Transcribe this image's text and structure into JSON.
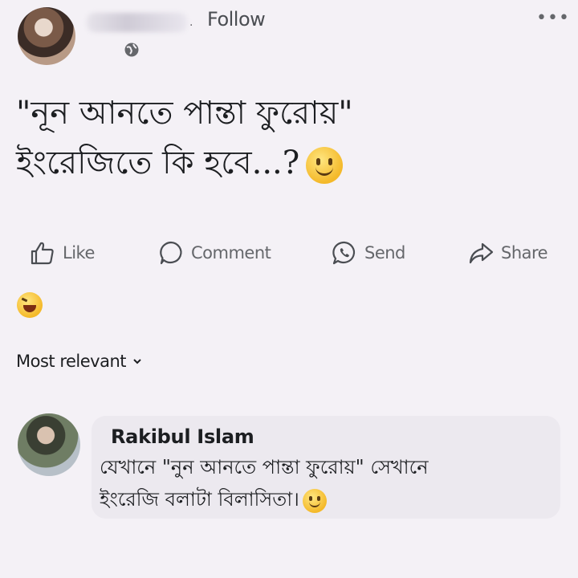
{
  "post": {
    "follow_label": "Follow",
    "dot_separator": "·",
    "more_label": "•••",
    "text_line1": "\"নূন আনতে পান্তা ফুরোয়\"",
    "text_line2": "ইংরেজিতে কি হবে...?"
  },
  "actions": {
    "like": "Like",
    "comment": "Comment",
    "send": "Send",
    "share": "Share"
  },
  "comments_section": {
    "sort_label": "Most relevant"
  },
  "comment": {
    "author": "Rakibul Islam",
    "text_line1": "যেখানে \"নুন আনতে পান্তা ফুরোয়\" সেখানে",
    "text_line2": "ইংরেজি বলাটা বিলাসিতা।"
  },
  "icons": {
    "header": [
      "avatar",
      "globe-icon",
      "more-icon"
    ],
    "actions": [
      "thumbs-up-icon",
      "comment-icon",
      "messenger-icon",
      "share-icon"
    ],
    "reaction": "haha-reaction-icon",
    "emoji": "smile-emoji-icon"
  },
  "colors": {
    "background": "#f4f1f6",
    "text": "#1c1e21",
    "muted": "#65676b",
    "bubble": "#ece9ef"
  }
}
